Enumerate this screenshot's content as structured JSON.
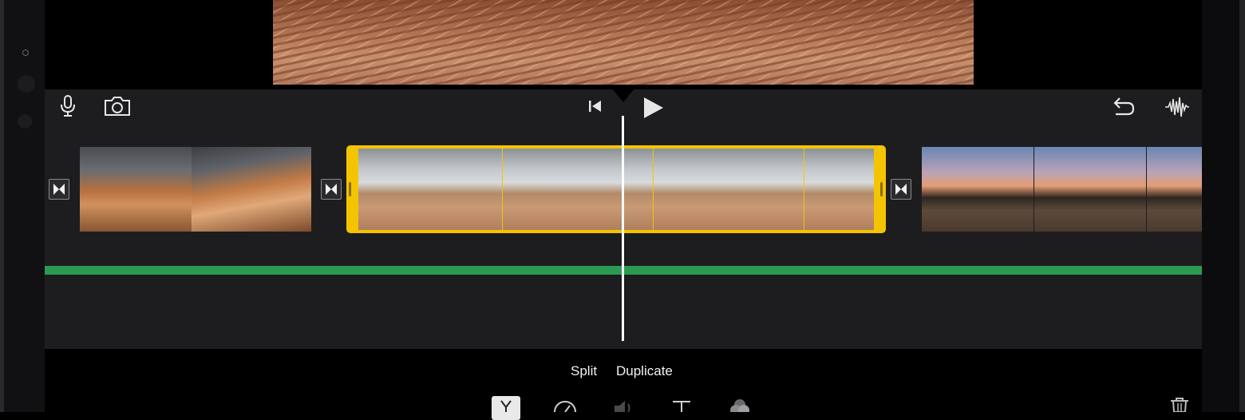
{
  "viewer": {
    "preview_description": "sandstone-preview"
  },
  "toolbar": {
    "icons": [
      "microphone-icon",
      "camera-icon",
      "skip-to-start-icon",
      "play-icon",
      "undo-icon",
      "audio-waveform-icon"
    ]
  },
  "timeline": {
    "clips": [
      {
        "name": "clip-1",
        "thumbs": 2
      },
      {
        "name": "clip-2-selected",
        "thumbs": 4,
        "selected": true
      },
      {
        "name": "clip-3",
        "thumbs": 3
      }
    ],
    "audio_track_color": "#2c9a52",
    "selection_color": "#f5c400"
  },
  "actions": {
    "split_label": "Split",
    "duplicate_label": "Duplicate"
  },
  "bottom_tools": {
    "icons": [
      "scissors-icon",
      "speed-icon",
      "volume-icon",
      "title-icon",
      "filter-icon",
      "trash-icon"
    ]
  }
}
